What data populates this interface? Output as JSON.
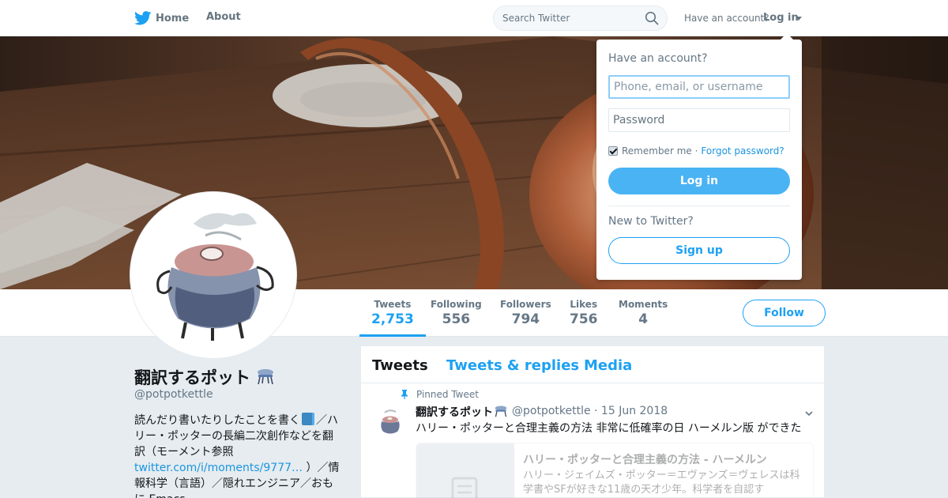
{
  "colors": {
    "accent": "#1da1f2",
    "link": "#1b95e0",
    "muted": "#657786",
    "background": "#e6ecf0"
  },
  "topnav": {
    "home_label": "Home",
    "about_label": "About",
    "search_placeholder": "Search Twitter",
    "have_account": "Have an account?",
    "login_label": "Log in",
    "icons": [
      "twitter-bird-icon",
      "search-icon",
      "caret-down-icon"
    ]
  },
  "profile": {
    "name": "翻訳するポット",
    "handle": "@potpotkettle",
    "bio": {
      "part1": "読んだり書いたりしたことを書く",
      "part2": "／ハリー・ポッターの長編二次創作などを翻訳（モーメント参照 ",
      "link": "twitter.com/i/moments/9777…",
      "part3": " ）／情報科学（言語）／隠れエンジニア／おもに Emacs"
    }
  },
  "stats": [
    {
      "label": "Tweets",
      "value": "2,753"
    },
    {
      "label": "Following",
      "value": "556"
    },
    {
      "label": "Followers",
      "value": "794"
    },
    {
      "label": "Likes",
      "value": "756"
    },
    {
      "label": "Moments",
      "value": "4"
    }
  ],
  "follow_label": "Follow",
  "timeline": {
    "tabs": [
      "Tweets",
      "Tweets & replies",
      "Media"
    ],
    "tweet": {
      "pinned": "Pinned Tweet",
      "name": "翻訳するポット",
      "meta": "@potpotkettle · 15 Jun 2018",
      "text": "ハリー・ポッターと合理主義の方法 非常に低確率の日 ハーメルン版 ができた",
      "card_title": "ハリー・ポッターと合理主義の方法 - ハーメルン",
      "card_desc": "ハリー・ジェイムズ・ポッター＝エヴァンズ＝ヴェレスは科学書やSFが好きな11歳の天才少年。科学者を自認す"
    }
  },
  "login_dropdown": {
    "question": "Have an account?",
    "user_placeholder": "Phone, email, or username",
    "password_placeholder": "Password",
    "remember": "Remember me ·",
    "forgot": "Forgot password?",
    "login_button": "Log in",
    "new_to_twitter": "New to Twitter?",
    "signup_button": "Sign up"
  }
}
